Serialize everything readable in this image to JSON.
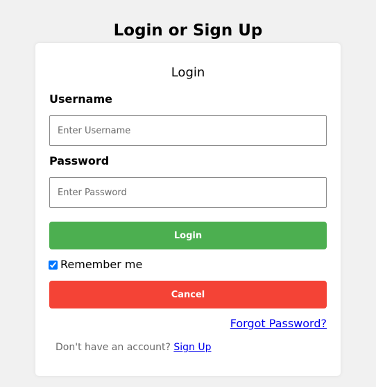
{
  "page": {
    "title": "Login or Sign Up"
  },
  "form": {
    "title": "Login",
    "username": {
      "label": "Username",
      "placeholder": "Enter Username",
      "value": ""
    },
    "password": {
      "label": "Password",
      "placeholder": "Enter Password",
      "value": ""
    },
    "login_button": "Login",
    "remember_me": {
      "label": "Remember me",
      "checked": true
    },
    "cancel_button": "Cancel",
    "forgot_password": "Forgot Password?",
    "signup_prompt": "Don't have an account?",
    "signup_link": "Sign Up"
  },
  "colors": {
    "login_button": "#4caf50",
    "cancel_button": "#f44336",
    "link": "#0000ee",
    "page_background": "#f1f1f1",
    "card_background": "#ffffff"
  }
}
